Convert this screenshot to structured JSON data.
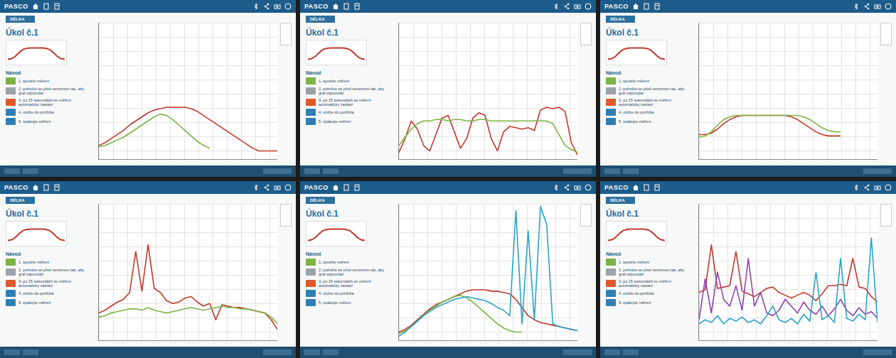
{
  "app": {
    "logo": "PASCO"
  },
  "sidebar": {
    "tab": "DÉLKA",
    "task": "Úkol č.1",
    "guide_title": "Návod",
    "reference": [
      1,
      1.2,
      1.8,
      2.8,
      3.6,
      3.9,
      4,
      4,
      4,
      4,
      3.9,
      3.6,
      2.8,
      1.8,
      1.2,
      1
    ],
    "steps": [
      {
        "text": "1. spusťte měření",
        "color": "#7cb342"
      },
      {
        "text": "2. pohněte se před senzorem tak, aby graf odpovídal",
        "color": "#9aa3a8"
      },
      {
        "text": "3. po 15 sekundách se měření automaticky zastaví",
        "color": "#e0592b"
      },
      {
        "text": "4. uložte do portfolia",
        "color": "#2f7fb5"
      },
      {
        "text": "5. opakujte měření",
        "color": "#2f7fb5"
      }
    ]
  },
  "panels": [
    {
      "series": [
        {
          "color": "#c0392b",
          "values": [
            1,
            1.2,
            1.5,
            1.8,
            2.1,
            2.5,
            2.8,
            3.1,
            3.4,
            3.6,
            3.7,
            3.8,
            3.8,
            3.8,
            3.8,
            3.7,
            3.5,
            3.2,
            2.9,
            2.6,
            2.3,
            2,
            1.7,
            1.4,
            1.1,
            0.8,
            0.6,
            0.6,
            0.6,
            0.6
          ]
        },
        {
          "color": "#7cb342",
          "values": [
            0.9,
            1,
            1.2,
            1.4,
            1.6,
            1.9,
            2.2,
            2.5,
            2.8,
            3.1,
            3.3,
            3.2,
            2.9,
            2.5,
            2.1,
            1.7,
            1.3,
            1,
            0.8
          ]
        }
      ]
    },
    {
      "series": [
        {
          "color": "#c0392b",
          "values": [
            0.5,
            1.5,
            2.8,
            2.2,
            1,
            0.6,
            1.8,
            3,
            3.2,
            2,
            0.8,
            1.5,
            3,
            3.4,
            3.2,
            1.5,
            0.6,
            2,
            2.4,
            2.3,
            2.2,
            2.3,
            2.1,
            3.6,
            3.8,
            3.7,
            3.8,
            3.5,
            1.2,
            0.3
          ]
        },
        {
          "color": "#7cb342",
          "values": [
            1,
            1.6,
            2.2,
            2.6,
            2.8,
            2.8,
            2.9,
            2.9,
            2.8,
            2.9,
            2.9,
            2.8,
            2.8,
            2.9,
            2.9,
            2.8,
            2.8,
            2.8,
            2.8,
            2.8,
            2.8,
            2.8,
            2.8,
            2.8,
            2.8,
            2.6,
            1.8,
            1,
            0.7,
            0.5
          ]
        }
      ]
    },
    {
      "series": [
        {
          "color": "#c0392b",
          "values": [
            1.8,
            1.8,
            1.9,
            2.2,
            2.6,
            2.9,
            3.1,
            3.2,
            3.2,
            3.2,
            3.2,
            3.2,
            3.2,
            3.2,
            3.2,
            3.1,
            2.9,
            2.6,
            2.3,
            2,
            1.8,
            1.7,
            1.7,
            1.7
          ]
        },
        {
          "color": "#7cb342",
          "values": [
            1.6,
            1.7,
            2,
            2.5,
            2.9,
            3.1,
            3.2,
            3.2,
            3.2,
            3.2,
            3.2,
            3.2,
            3.2,
            3.2,
            3.2,
            3.2,
            3.2,
            3.1,
            2.9,
            2.6,
            2.3,
            2.1,
            2,
            2
          ]
        }
      ]
    },
    {
      "series": [
        {
          "color": "#c0392b",
          "values": [
            2,
            2.2,
            2.5,
            2.8,
            3,
            3.5,
            6.5,
            3.6,
            7,
            3.8,
            3.5,
            2.9,
            2.7,
            2.8,
            3.1,
            3.2,
            2.8,
            2.5,
            2.7,
            1.5,
            2.6,
            2.5,
            2.4,
            2.4,
            2.3,
            2.2,
            2.1,
            2,
            1.5,
            0.8
          ]
        },
        {
          "color": "#7cb342",
          "values": [
            1.7,
            1.8,
            2,
            2.1,
            2.2,
            2.3,
            2.3,
            2.2,
            2.4,
            2.2,
            2.1,
            2,
            2.1,
            2.2,
            2.3,
            2.4,
            2.3,
            2.2,
            2.3,
            2.4,
            2.5,
            2.4,
            2.4,
            2.3,
            2.3,
            2.2,
            2.1,
            2,
            1.7,
            1.2
          ]
        }
      ]
    },
    {
      "series": [
        {
          "color": "#c0392b",
          "values": [
            0.6,
            0.8,
            1.1,
            1.5,
            1.9,
            2.3,
            2.6,
            2.8,
            3,
            3.2,
            3.4,
            3.6,
            3.7,
            3.7,
            3.7,
            3.6,
            3.6,
            3.5,
            3.4,
            3,
            2.4,
            1.8,
            1.5,
            1.3,
            1.2,
            1.1,
            1,
            0.9,
            0.8,
            0.7
          ]
        },
        {
          "color": "#7cb342",
          "values": [
            0.5,
            0.7,
            1,
            1.4,
            1.8,
            2.2,
            2.5,
            2.8,
            3,
            3.2,
            3.3,
            3.1,
            2.8,
            2.4,
            2,
            1.6,
            1.2,
            0.9,
            0.7,
            0.6,
            0.6
          ]
        },
        {
          "color": "#29a3c7",
          "values": [
            0.3,
            0.6,
            1,
            1.4,
            1.8,
            2.1,
            2.4,
            2.6,
            2.8,
            3,
            3.1,
            3.2,
            3.1,
            3,
            2.9,
            2.7,
            2.4,
            2.2,
            1.8,
            9.5,
            1.2,
            8,
            1.5,
            9.8,
            8.5,
            1.2,
            1,
            0.9,
            0.8,
            0.7
          ]
        }
      ]
    },
    {
      "series": [
        {
          "color": "#c0392b",
          "values": [
            3.5,
            3.7,
            7,
            3.8,
            3.9,
            4,
            6.5,
            3.6,
            3.4,
            3.2,
            3.5,
            3.8,
            3.9,
            3.5,
            3.3,
            3.1,
            3.3,
            3.5,
            3.3,
            2.9,
            3.4,
            4,
            4,
            4.1,
            4,
            6,
            3.9,
            3.8,
            3.2,
            2.8
          ]
        },
        {
          "color": "#8e44ad",
          "values": [
            1.5,
            4.5,
            2,
            5,
            3,
            2.5,
            4,
            2.2,
            6,
            2.5,
            3.5,
            2,
            1.8,
            2.2,
            3,
            2.5,
            2,
            2.8,
            2.2,
            1.9,
            2.5,
            1.8,
            2.3,
            3,
            2.2,
            1.8,
            2.4,
            1.9,
            2.1,
            1.6
          ]
        },
        {
          "color": "#29a3c7",
          "values": [
            1.2,
            1.5,
            1.3,
            1.8,
            1.2,
            1.6,
            1.4,
            1.7,
            1.3,
            1.5,
            1.2,
            1.8,
            2.5,
            1.5,
            1.3,
            1.6,
            1.2,
            1.9,
            1.4,
            5,
            1.5,
            1.8,
            1.3,
            6,
            1.6,
            1.4,
            1.9,
            1.5,
            7.5,
            1.3
          ]
        }
      ]
    }
  ]
}
